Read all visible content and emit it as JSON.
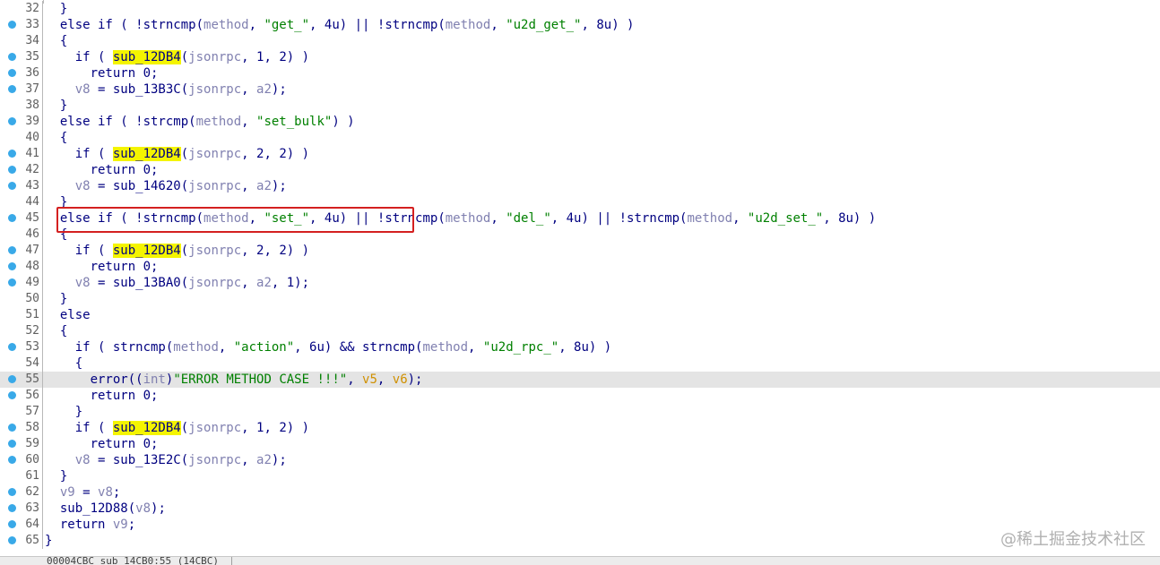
{
  "lines": [
    {
      "no": "32",
      "dot": false,
      "t": [
        [
          "plain",
          "  }"
        ]
      ]
    },
    {
      "no": "33",
      "dot": true,
      "t": [
        [
          "plain",
          "  else if ( !strncmp("
        ],
        [
          "var",
          "method"
        ],
        [
          "plain",
          ", "
        ],
        [
          "str",
          "\"get_\""
        ],
        [
          "plain",
          ", 4u) || !strncmp("
        ],
        [
          "var",
          "method"
        ],
        [
          "plain",
          ", "
        ],
        [
          "str",
          "\"u2d_get_\""
        ],
        [
          "plain",
          ", 8u) )"
        ]
      ]
    },
    {
      "no": "34",
      "dot": false,
      "t": [
        [
          "plain",
          "  {"
        ]
      ]
    },
    {
      "no": "35",
      "dot": true,
      "t": [
        [
          "plain",
          "    if ( "
        ],
        [
          "hl",
          "sub_12DB4"
        ],
        [
          "plain",
          "("
        ],
        [
          "var",
          "jsonrpc"
        ],
        [
          "plain",
          ", 1, 2) )"
        ]
      ]
    },
    {
      "no": "36",
      "dot": true,
      "t": [
        [
          "plain",
          "      return 0;"
        ]
      ]
    },
    {
      "no": "37",
      "dot": true,
      "t": [
        [
          "plain",
          "    "
        ],
        [
          "var",
          "v8"
        ],
        [
          "plain",
          " = sub_13B3C("
        ],
        [
          "var",
          "jsonrpc"
        ],
        [
          "plain",
          ", "
        ],
        [
          "var",
          "a2"
        ],
        [
          "plain",
          ");"
        ]
      ]
    },
    {
      "no": "38",
      "dot": false,
      "t": [
        [
          "plain",
          "  }"
        ]
      ]
    },
    {
      "no": "39",
      "dot": true,
      "t": [
        [
          "plain",
          "  else if ( !strcmp("
        ],
        [
          "var",
          "method"
        ],
        [
          "plain",
          ", "
        ],
        [
          "str",
          "\"set_bulk\""
        ],
        [
          "plain",
          ") )"
        ]
      ]
    },
    {
      "no": "40",
      "dot": false,
      "t": [
        [
          "plain",
          "  {"
        ]
      ]
    },
    {
      "no": "41",
      "dot": true,
      "t": [
        [
          "plain",
          "    if ( "
        ],
        [
          "hl",
          "sub_12DB4"
        ],
        [
          "plain",
          "("
        ],
        [
          "var",
          "jsonrpc"
        ],
        [
          "plain",
          ", 2, 2) )"
        ]
      ]
    },
    {
      "no": "42",
      "dot": true,
      "t": [
        [
          "plain",
          "      return 0;"
        ]
      ]
    },
    {
      "no": "43",
      "dot": true,
      "t": [
        [
          "plain",
          "    "
        ],
        [
          "var",
          "v8"
        ],
        [
          "plain",
          " = sub_14620("
        ],
        [
          "var",
          "jsonrpc"
        ],
        [
          "plain",
          ", "
        ],
        [
          "var",
          "a2"
        ],
        [
          "plain",
          ");"
        ]
      ]
    },
    {
      "no": "44",
      "dot": false,
      "t": [
        [
          "plain",
          "  }"
        ]
      ]
    },
    {
      "no": "45",
      "dot": true,
      "t": [
        [
          "plain",
          "  else if ( !strncmp("
        ],
        [
          "var",
          "method"
        ],
        [
          "plain",
          ", "
        ],
        [
          "str",
          "\"set_\""
        ],
        [
          "plain",
          ", 4u) || !strncmp("
        ],
        [
          "var",
          "method"
        ],
        [
          "plain",
          ", "
        ],
        [
          "str",
          "\"del_\""
        ],
        [
          "plain",
          ", 4u) || !strncmp("
        ],
        [
          "var",
          "method"
        ],
        [
          "plain",
          ", "
        ],
        [
          "str",
          "\"u2d_set_\""
        ],
        [
          "plain",
          ", 8u) )"
        ]
      ]
    },
    {
      "no": "46",
      "dot": false,
      "t": [
        [
          "plain",
          "  {"
        ]
      ]
    },
    {
      "no": "47",
      "dot": true,
      "t": [
        [
          "plain",
          "    if ( "
        ],
        [
          "hl",
          "sub_12DB4"
        ],
        [
          "plain",
          "("
        ],
        [
          "var",
          "jsonrpc"
        ],
        [
          "plain",
          ", 2, 2) )"
        ]
      ]
    },
    {
      "no": "48",
      "dot": true,
      "t": [
        [
          "plain",
          "      return 0;"
        ]
      ]
    },
    {
      "no": "49",
      "dot": true,
      "t": [
        [
          "plain",
          "    "
        ],
        [
          "var",
          "v8"
        ],
        [
          "plain",
          " = sub_13BA0("
        ],
        [
          "var",
          "jsonrpc"
        ],
        [
          "plain",
          ", "
        ],
        [
          "var",
          "a2"
        ],
        [
          "plain",
          ", 1);"
        ]
      ]
    },
    {
      "no": "50",
      "dot": false,
      "t": [
        [
          "plain",
          "  }"
        ]
      ]
    },
    {
      "no": "51",
      "dot": false,
      "t": [
        [
          "plain",
          "  else"
        ]
      ]
    },
    {
      "no": "52",
      "dot": false,
      "t": [
        [
          "plain",
          "  {"
        ]
      ]
    },
    {
      "no": "53",
      "dot": true,
      "t": [
        [
          "plain",
          "    if ( strncmp("
        ],
        [
          "var",
          "method"
        ],
        [
          "plain",
          ", "
        ],
        [
          "str",
          "\"action\""
        ],
        [
          "plain",
          ", 6u) && strncmp("
        ],
        [
          "var",
          "method"
        ],
        [
          "plain",
          ", "
        ],
        [
          "str",
          "\"u2d_rpc_\""
        ],
        [
          "plain",
          ", 8u) )"
        ]
      ]
    },
    {
      "no": "54",
      "dot": false,
      "t": [
        [
          "plain",
          "    {"
        ]
      ]
    },
    {
      "no": "55",
      "dot": true,
      "current": true,
      "t": [
        [
          "plain",
          "      error(("
        ],
        [
          "var",
          "int"
        ],
        [
          "plain",
          ")"
        ],
        [
          "str",
          "\"ERROR METHOD CASE !!!\""
        ],
        [
          "plain",
          ", "
        ],
        [
          "arg",
          "v5"
        ],
        [
          "plain",
          ", "
        ],
        [
          "arg",
          "v6"
        ],
        [
          "plain",
          ");"
        ]
      ]
    },
    {
      "no": "56",
      "dot": true,
      "t": [
        [
          "plain",
          "      return 0;"
        ]
      ]
    },
    {
      "no": "57",
      "dot": false,
      "t": [
        [
          "plain",
          "    }"
        ]
      ]
    },
    {
      "no": "58",
      "dot": true,
      "t": [
        [
          "plain",
          "    if ( "
        ],
        [
          "hl",
          "sub_12DB4"
        ],
        [
          "plain",
          "("
        ],
        [
          "var",
          "jsonrpc"
        ],
        [
          "plain",
          ", 1, 2) )"
        ]
      ]
    },
    {
      "no": "59",
      "dot": true,
      "t": [
        [
          "plain",
          "      return 0;"
        ]
      ]
    },
    {
      "no": "60",
      "dot": true,
      "t": [
        [
          "plain",
          "    "
        ],
        [
          "var",
          "v8"
        ],
        [
          "plain",
          " = sub_13E2C("
        ],
        [
          "var",
          "jsonrpc"
        ],
        [
          "plain",
          ", "
        ],
        [
          "var",
          "a2"
        ],
        [
          "plain",
          ");"
        ]
      ]
    },
    {
      "no": "61",
      "dot": false,
      "t": [
        [
          "plain",
          "  }"
        ]
      ]
    },
    {
      "no": "62",
      "dot": true,
      "t": [
        [
          "plain",
          "  "
        ],
        [
          "var",
          "v9"
        ],
        [
          "plain",
          " = "
        ],
        [
          "var",
          "v8"
        ],
        [
          "plain",
          ";"
        ]
      ]
    },
    {
      "no": "63",
      "dot": true,
      "t": [
        [
          "plain",
          "  sub_12D88("
        ],
        [
          "var",
          "v8"
        ],
        [
          "plain",
          ");"
        ]
      ]
    },
    {
      "no": "64",
      "dot": true,
      "t": [
        [
          "plain",
          "  return "
        ],
        [
          "var",
          "v9"
        ],
        [
          "plain",
          ";"
        ]
      ]
    },
    {
      "no": "65",
      "dot": true,
      "t": [
        [
          "plain",
          "}"
        ]
      ]
    }
  ],
  "status": {
    "location": "00004CBC sub_14CB0:55 (14CBC)"
  },
  "watermark": "@稀土掘金技术社区",
  "colors": {
    "identifier": "#000080",
    "variable": "#8080b0",
    "string": "#008000",
    "highlight_bg": "#f4f400",
    "argument": "#d09000",
    "breakpoint_dot": "#39a9e8",
    "annotation_box": "#d42020",
    "current_line": "#e4e4e4"
  }
}
